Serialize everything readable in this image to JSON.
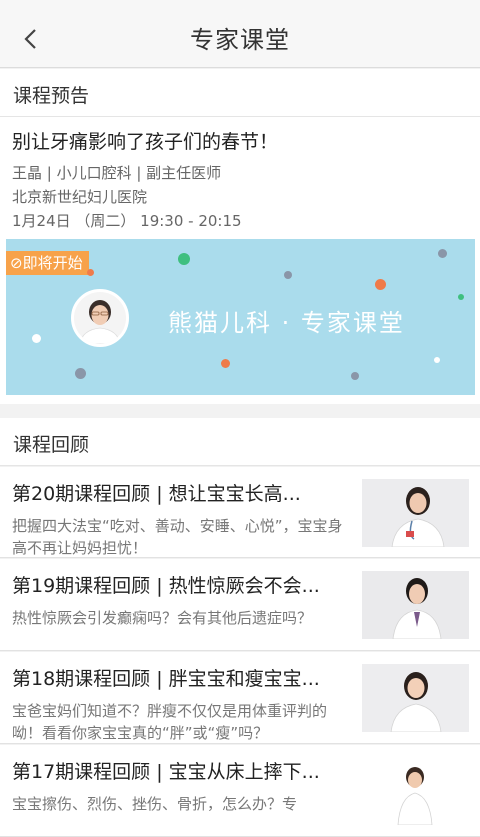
{
  "nav": {
    "title": "专家课堂",
    "back_icon": "chevron-left-icon"
  },
  "preview_section": {
    "heading": "课程预告"
  },
  "preview": {
    "title": "别让牙痛影响了孩子们的春节！",
    "doctor": "王晶 | 小儿口腔科 | 副主任医师",
    "hospital": "北京新世纪妇儿医院",
    "time": "1月24日 （周二） 19:30 - 20:15",
    "banner_tag": "⊘即将开始",
    "banner_text": "熊猫儿科 · 专家课堂",
    "banner_color": "#aadcec",
    "tag_color": "#f7a24a"
  },
  "review_section": {
    "heading": "课程回顾"
  },
  "reviews": [
    {
      "title": "第20期课程回顾 | 想让宝宝长高...",
      "desc": "把握四大法宝“吃对、善动、安睡、心悦”，宝宝身高不再让妈妈担忧！"
    },
    {
      "title": "第19期课程回顾 | 热性惊厥会不会...",
      "desc": "热性惊厥会引发癫痫吗？会有其他后遗症吗？"
    },
    {
      "title": "第18期课程回顾 | 胖宝宝和瘦宝宝...",
      "desc": "宝爸宝妈们知道不？胖瘦不仅仅是用体重评判的呦！看看你家宝宝真的“胖”或“瘦”吗？"
    },
    {
      "title": "第17期课程回顾 | 宝宝从床上摔下...",
      "desc": "宝宝擦伤、烈伤、挫伤、骨折，怎么办？专"
    }
  ]
}
